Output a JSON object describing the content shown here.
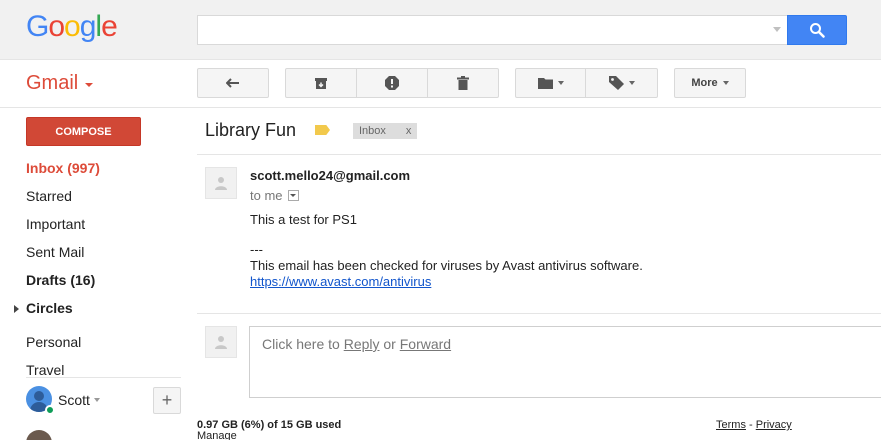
{
  "header": {
    "logo_letters": [
      {
        "ch": "G",
        "color": "#4285f4"
      },
      {
        "ch": "o",
        "color": "#ea4335"
      },
      {
        "ch": "o",
        "color": "#fbbc05"
      },
      {
        "ch": "g",
        "color": "#4285f4"
      },
      {
        "ch": "l",
        "color": "#34a853"
      },
      {
        "ch": "e",
        "color": "#ea4335"
      }
    ],
    "search": {
      "value": "",
      "placeholder": ""
    }
  },
  "toolbar": {
    "app_label": "Gmail",
    "more_label": "More"
  },
  "sidebar": {
    "compose_label": "COMPOSE",
    "items": [
      {
        "label": "Inbox (997)"
      },
      {
        "label": "Starred"
      },
      {
        "label": "Important"
      },
      {
        "label": "Sent Mail"
      },
      {
        "label": "Drafts (16)"
      },
      {
        "label": "Circles"
      },
      {
        "label": "Personal"
      },
      {
        "label": "Travel"
      }
    ],
    "user_name": "Scott",
    "add_label": "+"
  },
  "thread": {
    "subject": "Library Fun",
    "label_chip": "Inbox",
    "label_chip_close": "x",
    "message": {
      "sender": "scott.mello24@gmail.com",
      "to": "to me",
      "line1": "This a test for PS1",
      "separator": "---",
      "line2": "This email has been checked for viruses by Avast antivirus software.",
      "link": "https://www.avast.com/antivirus"
    },
    "reply": {
      "prefix": "Click here to ",
      "reply_link": "Reply",
      "or_text": " or ",
      "forward_link": "Forward"
    }
  },
  "footer": {
    "storage": "0.97 GB (6%) of 15 GB used",
    "manage": "Manage",
    "terms": "Terms",
    "separator": " - ",
    "privacy": "Privacy"
  },
  "colors": {
    "accent_red": "#dd4b39",
    "compose_red": "#d14836",
    "search_blue": "#4285f4",
    "link_blue": "#15c",
    "label_yellow": "#f2c94c"
  }
}
